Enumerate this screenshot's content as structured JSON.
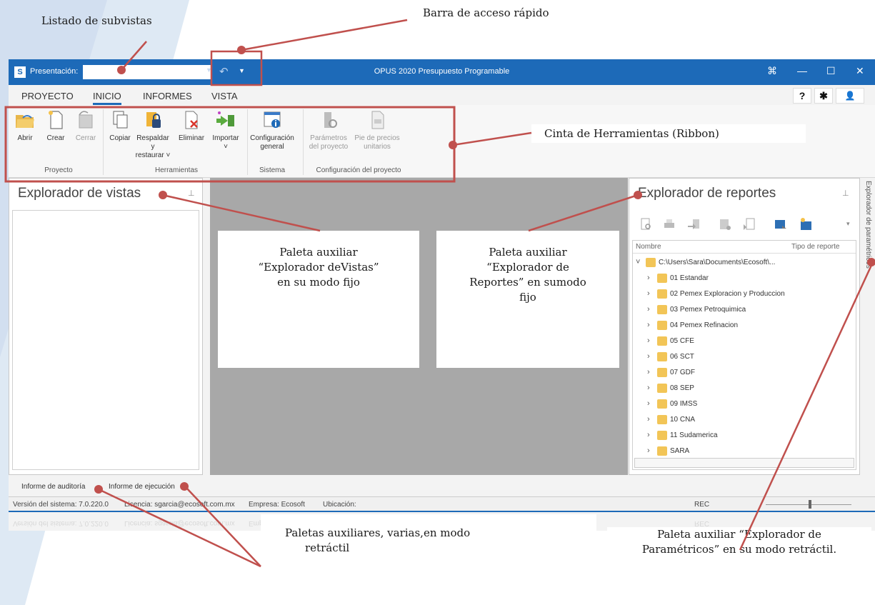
{
  "annotations": {
    "subviews_list": "Listado de subvistas",
    "quick_access": "Barra de acceso rápido",
    "ribbon": "Cinta de Herramientas (Ribbon)",
    "views_explorer": [
      "Paleta auxiliar",
      "“Explorador deVistas”",
      "en su modo fijo"
    ],
    "reports_explorer": [
      "Paleta auxiliar",
      "“Explorador de",
      "Reportes” en sumodo",
      "fijo"
    ],
    "retractable_palettes": [
      "Paletas auxiliares, varias,en modo",
      "retráctil"
    ],
    "parametric_explorer": [
      "Paleta auxiliar “Explorador de",
      "Paramétricos” en su modo retráctil."
    ]
  },
  "titlebar": {
    "logo": "S",
    "presentation_label": "Presentación:",
    "presentation_value": "",
    "title": "OPUS 2020 Presupuesto Programable",
    "controls": [
      "⌘",
      "—",
      "☐",
      "✕"
    ]
  },
  "menu": {
    "items": [
      "PROYECTO",
      "INICIO",
      "INFORMES",
      "VISTA"
    ],
    "active": "INICIO",
    "right_buttons": [
      "?",
      "✱",
      "👤"
    ]
  },
  "ribbon": {
    "buttons": [
      {
        "label": "Abrir",
        "icon": "folder-open-icon"
      },
      {
        "label": "Crear",
        "icon": "new-document-icon"
      },
      {
        "label": "Cerrar",
        "icon": "close-folder-icon"
      },
      {
        "label": "Copiar",
        "icon": "copy-icon"
      },
      {
        "label": "Respaldar y",
        "label2": "restaurar ˅",
        "icon": "backup-lock-icon"
      },
      {
        "label": "Eliminar",
        "icon": "delete-document-icon"
      },
      {
        "label": "Importar",
        "label2": "˅",
        "icon": "import-icon"
      },
      {
        "label": "Configuración",
        "label2": "general",
        "icon": "settings-info-icon"
      },
      {
        "label": "Parámetros",
        "label2": "del proyecto",
        "icon": "parameters-icon"
      },
      {
        "label": "Pie de precios",
        "label2": "unitarios",
        "icon": "unit-prices-icon"
      }
    ],
    "groups": [
      "Proyecto",
      "Herramientas",
      "Sistema",
      "Configuración del proyecto"
    ]
  },
  "views_explorer": {
    "title": "Explorador de vistas",
    "pin": "⊥"
  },
  "reports_explorer": {
    "title": "Explorador de reportes",
    "pin": "⊥",
    "columns": [
      "Nombre",
      "Tipo de reporte"
    ],
    "root": "C:\\Users\\Sara\\Documents\\Ecosoft\\...",
    "folders": [
      "01 Estandar",
      "02 Pemex Exploracion y Produccion",
      "03 Pemex Petroquimica",
      "04 Pemex Refinacion",
      "05 CFE",
      "06 SCT",
      "07 GDF",
      "08 SEP",
      "09 IMSS",
      "10 CNA",
      "11 Sudamerica",
      "SARA"
    ]
  },
  "side_tab": "Explorador de paramétricos",
  "bottom_tabs": [
    "Informe de auditoría",
    "Informe de ejecución"
  ],
  "status": {
    "version": "Versión del sistema: 7.0.220.0",
    "license": "Licencia: sgarcia@ecosoft.com.mx",
    "company": "Empresa: Ecosoft",
    "location": "Ubicación:",
    "rec": "REC"
  },
  "colors": {
    "accent": "#1d6ab8",
    "annotation": "#b94a48",
    "ribbon_highlight": "#c0504d"
  }
}
